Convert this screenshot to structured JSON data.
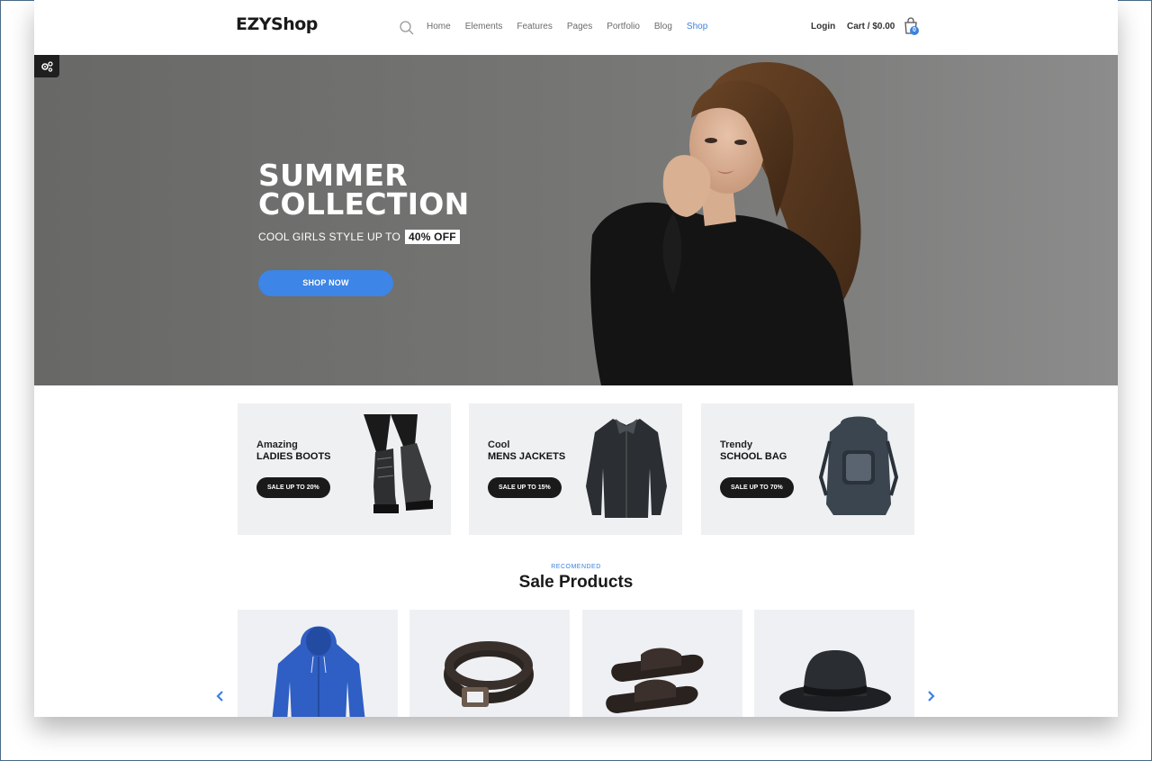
{
  "header": {
    "logo": "EZYShop",
    "nav": [
      "Home",
      "Elements",
      "Features",
      "Pages",
      "Portfolio",
      "Blog",
      "Shop"
    ],
    "active_nav": "Shop",
    "login": "Login",
    "cart": "Cart / $0.00",
    "cart_count": "0"
  },
  "hero": {
    "title_line1": "SUMMER",
    "title_line2": "COLLECTION",
    "subtitle": "COOL GIRLS STYLE UP TO",
    "discount": "40% OFF",
    "cta": "SHOP NOW"
  },
  "categories": [
    {
      "small": "Amazing",
      "big": "LADIES BOOTS",
      "button": "SALE UP TO 20%",
      "icon": "boots-image"
    },
    {
      "small": "Cool",
      "big": "MENS JACKETS",
      "button": "SALE UP TO 15%",
      "icon": "jacket-image"
    },
    {
      "small": "Trendy",
      "big": "SCHOOL BAG",
      "button": "SALE UP TO 70%",
      "icon": "backpack-image"
    }
  ],
  "section": {
    "eyebrow": "RECOMENDED",
    "title": "Sale Products"
  },
  "products": [
    {
      "icon": "hoodie-image"
    },
    {
      "icon": "belt-image"
    },
    {
      "icon": "sandals-image"
    },
    {
      "icon": "hat-image"
    }
  ],
  "colors": {
    "accent": "#3d85e6",
    "dark": "#1a1a1a",
    "card_bg": "#eef0f2"
  }
}
